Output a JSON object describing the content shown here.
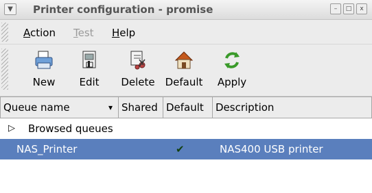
{
  "window": {
    "title": "Printer configuration - promise",
    "buttons": {
      "minimize": "–",
      "maximize": "□",
      "close": "x"
    }
  },
  "menubar": {
    "items": [
      {
        "label": "Action",
        "enabled": true
      },
      {
        "label": "Test",
        "enabled": false
      },
      {
        "label": "Help",
        "enabled": true
      }
    ]
  },
  "toolbar": {
    "buttons": [
      {
        "label": "New",
        "icon": "printer-new-icon"
      },
      {
        "label": "Edit",
        "icon": "edit-document-icon"
      },
      {
        "label": "Delete",
        "icon": "delete-scissors-icon"
      },
      {
        "label": "Default",
        "icon": "home-default-icon"
      },
      {
        "label": "Apply",
        "icon": "apply-refresh-icon"
      }
    ]
  },
  "list": {
    "columns": [
      {
        "label": "Queue name",
        "sortable": true
      },
      {
        "label": "Shared"
      },
      {
        "label": "Default"
      },
      {
        "label": "Description"
      }
    ],
    "rows": [
      {
        "expander": "▷",
        "queue": "Browsed queues",
        "shared": "",
        "default": "",
        "description": "",
        "selected": false
      },
      {
        "queue": "NAS_Printer",
        "shared": "",
        "default": "✔",
        "description": "NAS400 USB printer",
        "selected": true
      }
    ],
    "sort_icon": "▾"
  },
  "colors": {
    "selection": "#5a7fbd",
    "chrome": "#ececec"
  }
}
